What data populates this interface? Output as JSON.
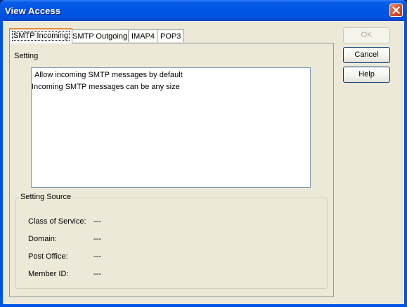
{
  "window": {
    "title": "View Access"
  },
  "tabs": [
    {
      "label": "SMTP Incoming",
      "active": true
    },
    {
      "label": "SMTP Outgoing",
      "active": false
    },
    {
      "label": "IMAP4",
      "active": false
    },
    {
      "label": "POP3",
      "active": false
    }
  ],
  "panel": {
    "setting_label": "Setting",
    "settings": [
      "Allow incoming SMTP messages by default",
      "Incoming SMTP messages can be any size"
    ],
    "source_title": "Setting Source",
    "source_fields": [
      {
        "label": "Class of Service:",
        "value": "---"
      },
      {
        "label": "Domain:",
        "value": "---"
      },
      {
        "label": "Post Office:",
        "value": "---"
      },
      {
        "label": "Member ID:",
        "value": "---"
      }
    ]
  },
  "buttons": {
    "ok": {
      "label": "OK",
      "enabled": false
    },
    "cancel": {
      "label": "Cancel",
      "enabled": true
    },
    "help": {
      "label": "Help",
      "enabled": true
    }
  },
  "icons": {
    "close": "close-icon"
  },
  "colors": {
    "titlebar": "#0055e5",
    "close": "#d9552f",
    "face": "#ece9d8",
    "active_tab_accent": "#e68b2c"
  }
}
